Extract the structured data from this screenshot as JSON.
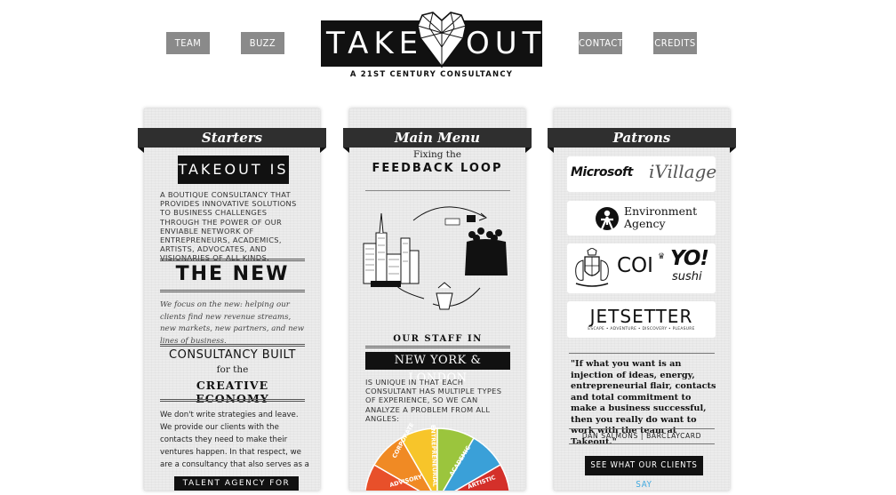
{
  "nav": {
    "team": "TEAM",
    "buzz": "BUZZ",
    "contact": "CONTACT",
    "credits": "CREDITS"
  },
  "logo": {
    "left_word": "TAKE",
    "right_word": "OUT",
    "tagline": "A 21ST CENTURY CONSULTANCY"
  },
  "starters": {
    "ribbon": "Starters",
    "takeout_is": "TAKEOUT IS",
    "intro": "A BOUTIQUE CONSULTANCY THAT PROVIDES INNOVATIVE SOLUTIONS TO BUSINESS CHALLENGES THROUGH THE POWER OF OUR ENVIABLE NETWORK OF ENTREPRENEURS, ACADEMICS, ARTISTS, ADVOCATES, AND VISIONARIES OF ALL KINDS.",
    "the_new": "THE NEW",
    "new_text": "We focus on the new: helping our clients find new revenue streams, new markets, new partners, and new lines of business.",
    "built_line1": "CONSULTANCY BUILT",
    "built_line2": "for the",
    "built_line3": "CREATIVE ECONOMY",
    "strategy_text": "We don't write strategies and leave. We provide our clients with the contacts they need to make their ventures happen. In that respect, we are a consultancy that also serves as a",
    "talent_box": "TALENT AGENCY FOR"
  },
  "main_menu": {
    "ribbon": "Main Menu",
    "fixing": "Fixing the",
    "feedback_loop": "FEEDBACK LOOP",
    "staff_in": "OUR STAFF IN",
    "ny_london": "NEW YORK & LONDON",
    "staff_text": "IS UNIQUE IN THAT EACH CONSULTANT HAS MULTIPLE TYPES OF EXPERIENCE, SO WE CAN ANALYZE A PROBLEM FROM ALL ANGLES:",
    "wheel_labels": [
      "CORPORATE",
      "ENTREPRENEURIAL",
      "ACADEMIC",
      "ADVISORY",
      "ARTISTIC"
    ],
    "wheel_colors": [
      "#e8502a",
      "#f08a24",
      "#f7c52a",
      "#9bc53d",
      "#3aa0d8",
      "#d4302a"
    ]
  },
  "patrons": {
    "ribbon": "Patrons",
    "logos": [
      "Microsoft",
      "iVillage",
      "Environment",
      "Agency",
      "COI",
      "YO!",
      "sushi",
      "JETSETTER",
      "ESCAPE • ADVENTURE • DISCOVERY • PLEASURE"
    ],
    "quote": "\"If what you want is an injection of ideas, energy, entrepreneurial flair, contacts and total commitment to make a business successful, then you really do want to work with the team at Takeout.\"",
    "attribution": "DAN SALMONS | BARCLAYCARD",
    "cta_prefix": "SEE WHAT OUR CLIENTS",
    "cta_say": "SAY"
  }
}
